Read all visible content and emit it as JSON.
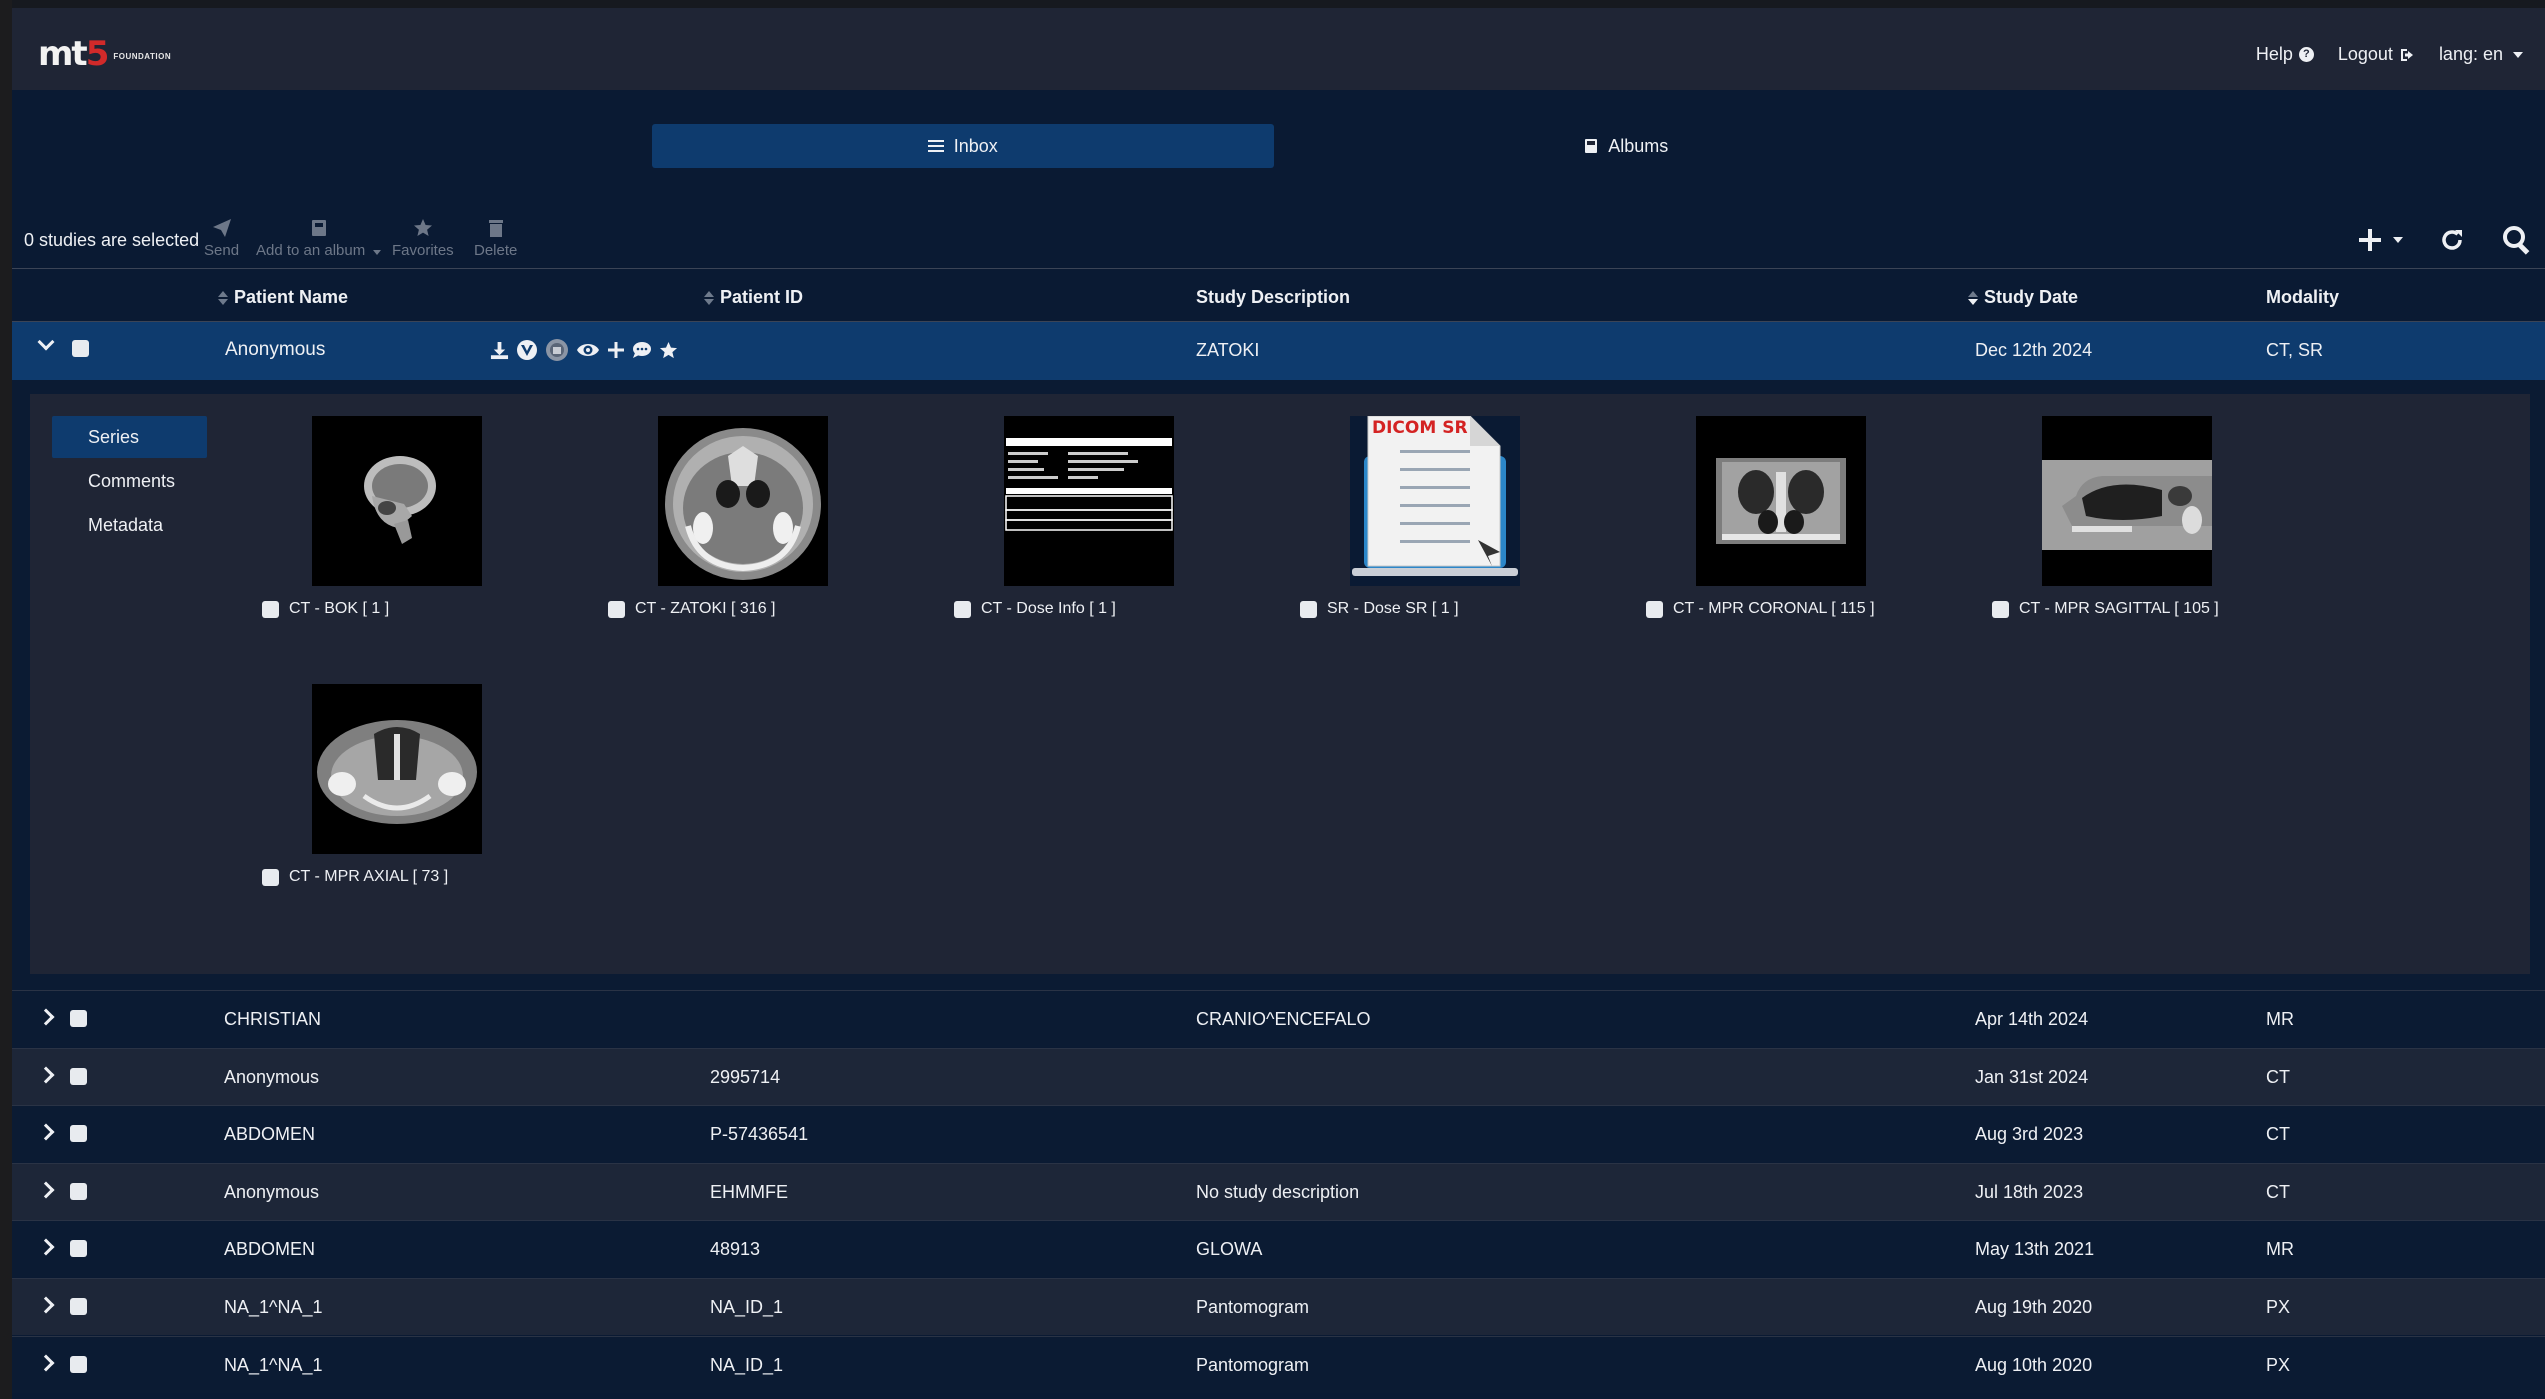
{
  "header": {
    "logo_text": "mt",
    "logo_accent": "5",
    "logo_sub": "FOUNDATION",
    "help": "Help",
    "logout": "Logout",
    "lang": "lang: en"
  },
  "tabs": [
    {
      "label": "Inbox",
      "active": true
    },
    {
      "label": "Albums",
      "active": false
    }
  ],
  "toolbar": {
    "selected_count": "0 studies are selected",
    "send": "Send",
    "add_album": "Add to an album",
    "favorites": "Favorites",
    "delete": "Delete"
  },
  "columns": {
    "patient_name": "Patient Name",
    "patient_id": "Patient ID",
    "study_description": "Study Description",
    "study_date": "Study Date",
    "modality": "Modality"
  },
  "expanded_study": {
    "patient_name": "Anonymous",
    "patient_id": "",
    "study_description": "ZATOKI",
    "study_date": "Dec 12th 2024",
    "modality": "CT, SR",
    "menu": [
      "Series",
      "Comments",
      "Metadata"
    ],
    "dicom_sr_badge": "DICOM SR",
    "series": [
      {
        "label": "CT - BOK [ 1 ]",
        "kind": "skull"
      },
      {
        "label": "CT - ZATOKI [ 316 ]",
        "kind": "axial"
      },
      {
        "label": "CT - Dose Info [ 1 ]",
        "kind": "dose"
      },
      {
        "label": "SR - Dose SR [ 1 ]",
        "kind": "sr"
      },
      {
        "label": "CT - MPR CORONAL [ 115 ]",
        "kind": "coronal"
      },
      {
        "label": "CT - MPR SAGITTAL [ 105 ]",
        "kind": "sagittal"
      },
      {
        "label": "CT - MPR AXIAL [ 73 ]",
        "kind": "axial2"
      }
    ]
  },
  "rows": [
    {
      "patient_name": "CHRISTIAN",
      "patient_id": "",
      "study_description": "CRANIO^ENCEFALO",
      "study_date": "Apr 14th 2024",
      "modality": "MR"
    },
    {
      "patient_name": "Anonymous",
      "patient_id": "2995714",
      "study_description": "",
      "study_date": "Jan 31st 2024",
      "modality": "CT"
    },
    {
      "patient_name": "ABDOMEN",
      "patient_id": "P-57436541",
      "study_description": "",
      "study_date": "Aug 3rd 2023",
      "modality": "CT"
    },
    {
      "patient_name": "Anonymous",
      "patient_id": "EHMMFE",
      "study_description": "No study description",
      "study_date": "Jul 18th 2023",
      "modality": "CT"
    },
    {
      "patient_name": "ABDOMEN",
      "patient_id": "48913",
      "study_description": "GLOWA",
      "study_date": "May 13th 2021",
      "modality": "MR"
    },
    {
      "patient_name": "NA_1^NA_1",
      "patient_id": "NA_ID_1",
      "study_description": "Pantomogram",
      "study_date": "Aug 19th 2020",
      "modality": "PX"
    },
    {
      "patient_name": "NA_1^NA_1",
      "patient_id": "NA_ID_1",
      "study_description": "Pantomogram",
      "study_date": "Aug 10th 2020",
      "modality": "PX"
    }
  ],
  "colors": {
    "background": "#0a1a33",
    "header": "#1f2535",
    "accent": "#0e3b6e",
    "logo_red": "#d12a2a"
  }
}
